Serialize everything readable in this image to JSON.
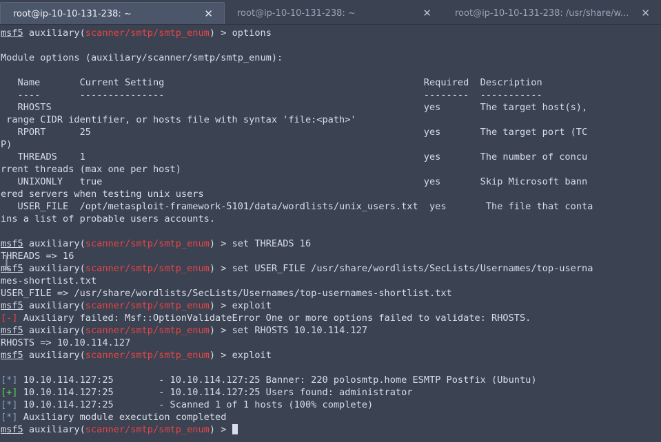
{
  "window": {
    "background_color": "#3b4252",
    "foreground_color": "#d8dee9"
  },
  "tabs": [
    {
      "title": "root@ip-10-10-131-238: ~",
      "active": true,
      "close_label": "✕"
    },
    {
      "title": "root@ip-10-10-131-238: ~",
      "active": false,
      "close_label": "✕"
    },
    {
      "title": "root@ip-10-10-131-238: /usr/share/w...",
      "active": false,
      "close_label": "✕"
    }
  ],
  "prompt": {
    "user": "msf5",
    "command_word": " auxiliary(",
    "module": "scanner/smtp/smtp_enum",
    "suffix": ") > "
  },
  "colors": {
    "module_red": "#e84545",
    "status_info_blue": "#81a1c1",
    "status_good_green": "#5fd75f",
    "status_bad_red": "#e84545",
    "prompt_white": "#d8dee9",
    "tab_active_bg": "#4c566a",
    "tab_inactive_fg": "#9aa3b4"
  },
  "terminal": {
    "cursor_glyph": "█",
    "lines": [
      {
        "type": "prompt",
        "command": "options"
      },
      {
        "type": "blank",
        "text": ""
      },
      {
        "type": "text",
        "text": "Module options (auxiliary/scanner/smtp/smtp_enum):"
      },
      {
        "type": "blank",
        "text": ""
      },
      {
        "type": "text",
        "text": "   Name       Current Setting                                              Required  Description"
      },
      {
        "type": "text",
        "text": "   ----       ---------------                                              --------  -----------"
      },
      {
        "type": "text",
        "text": "   RHOSTS                                                                  yes       The target host(s),"
      },
      {
        "type": "text",
        "text": " range CIDR identifier, or hosts file with syntax 'file:<path>'"
      },
      {
        "type": "text",
        "text": "   RPORT      25                                                           yes       The target port (TC"
      },
      {
        "type": "text",
        "text": "P)"
      },
      {
        "type": "text",
        "text": "   THREADS    1                                                            yes       The number of concu"
      },
      {
        "type": "text",
        "text": "rrent threads (max one per host)"
      },
      {
        "type": "text",
        "text": "   UNIXONLY   true                                                         yes       Skip Microsoft bann"
      },
      {
        "type": "text",
        "text": "ered servers when testing unix users"
      },
      {
        "type": "text",
        "text": "   USER_FILE  /opt/metasploit-framework-5101/data/wordlists/unix_users.txt  yes       The file that conta"
      },
      {
        "type": "text",
        "text": "ins a list of probable users accounts."
      },
      {
        "type": "blank",
        "text": ""
      },
      {
        "type": "prompt",
        "command": "set THREADS 16"
      },
      {
        "type": "text",
        "text": "THREADS => 16"
      },
      {
        "type": "prompt",
        "command": "set USER_FILE /usr/share/wordlists/SecLists/Usernames/top-userna"
      },
      {
        "type": "text",
        "text": "mes-shortlist.txt"
      },
      {
        "type": "text",
        "text": "USER_FILE => /usr/share/wordlists/SecLists/Usernames/top-usernames-shortlist.txt"
      },
      {
        "type": "prompt",
        "command": "exploit"
      },
      {
        "type": "status",
        "marker": "[-]",
        "marker_class": "minus",
        "text": " Auxiliary failed: Msf::OptionValidateError One or more options failed to validate: RHOSTS."
      },
      {
        "type": "prompt",
        "command": "set RHOSTS 10.10.114.127"
      },
      {
        "type": "text",
        "text": "RHOSTS => 10.10.114.127"
      },
      {
        "type": "prompt",
        "command": "exploit"
      },
      {
        "type": "blank",
        "text": ""
      },
      {
        "type": "status",
        "marker": "[*]",
        "marker_class": "star",
        "text": " 10.10.114.127:25        - 10.10.114.127:25 Banner: 220 polosmtp.home ESMTP Postfix (Ubuntu)"
      },
      {
        "type": "status",
        "marker": "[+]",
        "marker_class": "plus",
        "text": " 10.10.114.127:25        - 10.10.114.127:25 Users found: administrator"
      },
      {
        "type": "status",
        "marker": "[*]",
        "marker_class": "star",
        "text": " 10.10.114.127:25        - Scanned 1 of 1 hosts (100% complete)"
      },
      {
        "type": "status",
        "marker": "[*]",
        "marker_class": "star",
        "text": " Auxiliary module execution completed"
      },
      {
        "type": "prompt_cursor",
        "command": ""
      }
    ]
  }
}
